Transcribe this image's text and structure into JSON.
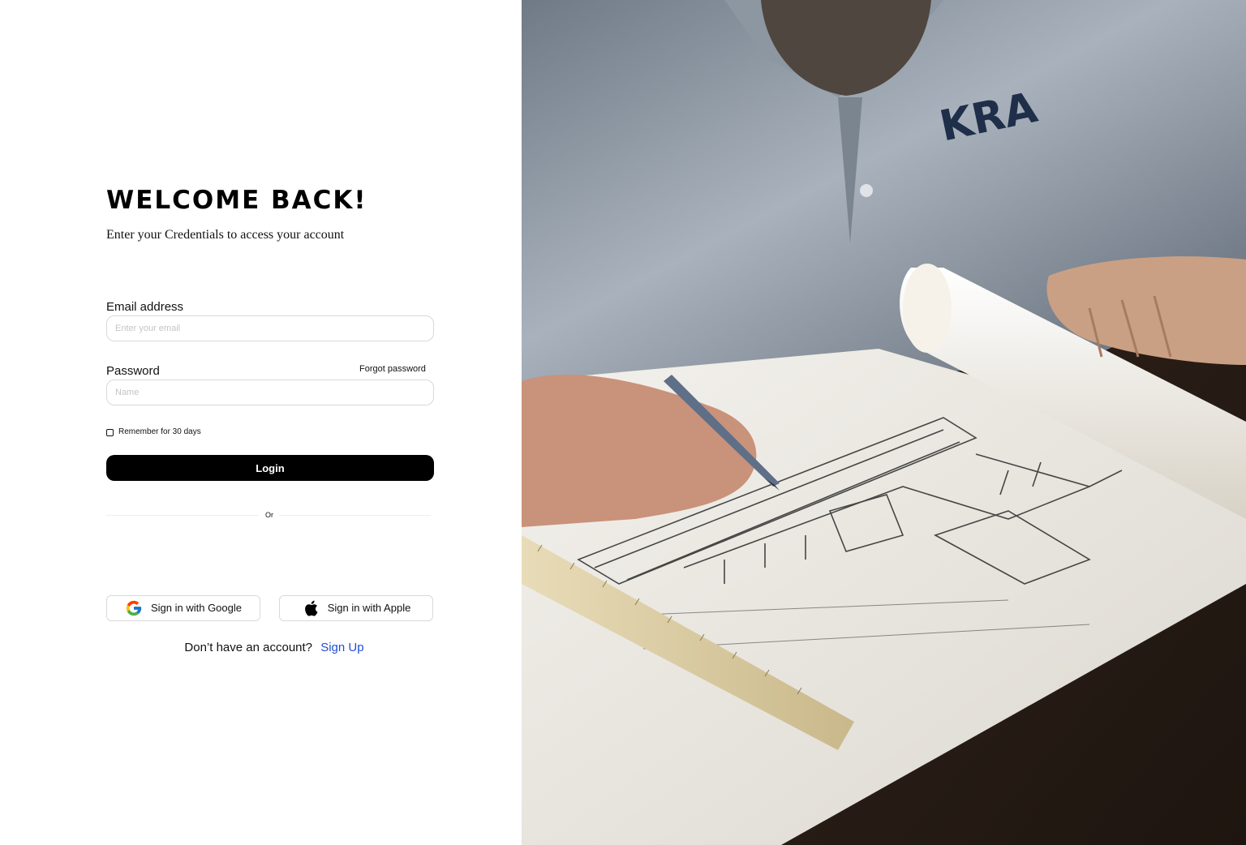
{
  "login": {
    "heading": "WELCOME BACK!",
    "subheading": "Enter your Credentials to access your account",
    "email": {
      "label": "Email address",
      "placeholder": "Enter your email",
      "value": ""
    },
    "password": {
      "label": "Password",
      "placeholder": "Name",
      "value": "",
      "forgot_label": "Forgot password"
    },
    "remember": {
      "label": "Remember for 30 days",
      "checked": false
    },
    "login_button": "Login",
    "divider_text": "Or",
    "social": {
      "google_label": "Sign in with Google",
      "google_icon": "google-icon",
      "apple_label": "Sign in with Apple",
      "apple_icon": "apple-icon"
    },
    "signup": {
      "prompt": "Don’t have an account?",
      "link_label": "Sign Up"
    }
  },
  "photo": {
    "shirt_logo": "KRA"
  },
  "colors": {
    "primary_button": "#000000",
    "link": "#1f4fd8",
    "input_border": "#d9d9d9",
    "background": "#ffffff"
  }
}
